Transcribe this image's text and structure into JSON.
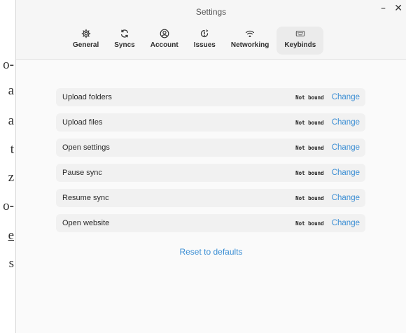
{
  "background_document": {
    "fragments": [
      "o-",
      "a",
      "a",
      "t",
      "z",
      "o-",
      "e",
      "s"
    ]
  },
  "window": {
    "title": "Settings",
    "minimize_glyph": "–",
    "close_glyph": "✕"
  },
  "tabs": [
    {
      "label": "General",
      "icon": "gear-icon"
    },
    {
      "label": "Syncs",
      "icon": "sync-icon"
    },
    {
      "label": "Account",
      "icon": "account-icon"
    },
    {
      "label": "Issues",
      "icon": "issues-icon"
    },
    {
      "label": "Networking",
      "icon": "wifi-icon"
    },
    {
      "label": "Keybinds",
      "icon": "keyboard-icon",
      "active": true
    }
  ],
  "keybinds": [
    {
      "label": "Upload folders",
      "status": "Not bound",
      "action": "Change"
    },
    {
      "label": "Upload files",
      "status": "Not bound",
      "action": "Change"
    },
    {
      "label": "Open settings",
      "status": "Not bound",
      "action": "Change"
    },
    {
      "label": "Pause sync",
      "status": "Not bound",
      "action": "Change"
    },
    {
      "label": "Resume sync",
      "status": "Not bound",
      "action": "Change"
    },
    {
      "label": "Open website",
      "status": "Not bound",
      "action": "Change"
    }
  ],
  "reset_label": "Reset to defaults",
  "colors": {
    "accent": "#3d8fd4",
    "row_background": "#f1f1f1",
    "active_tab": "#ebebeb"
  }
}
